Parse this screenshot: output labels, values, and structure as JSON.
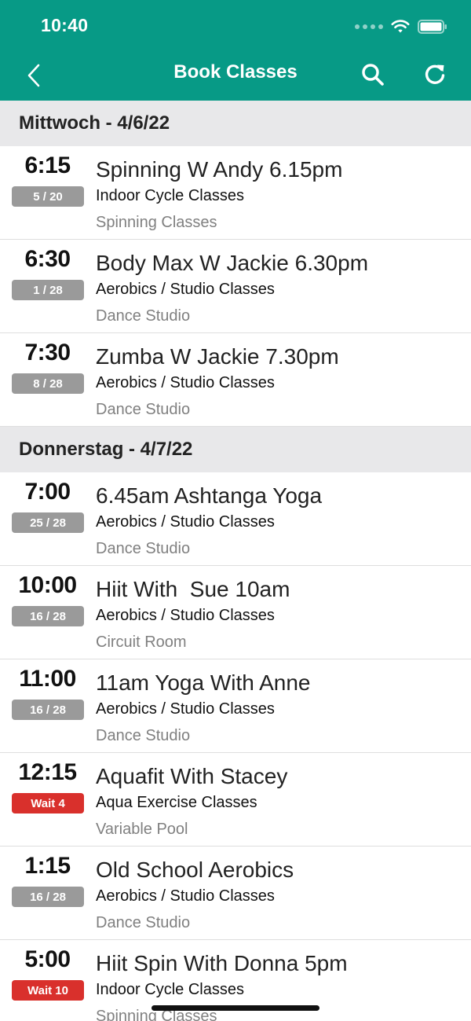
{
  "status_bar": {
    "time": "10:40"
  },
  "nav": {
    "title": "Book Classes",
    "back_icon": "chevron-left-icon",
    "search_icon": "search-icon",
    "refresh_icon": "refresh-icon"
  },
  "colors": {
    "primary": "#079A86",
    "badge_gray": "#9a9a9a",
    "badge_wait": "#d9302c"
  },
  "days": [
    {
      "header": "Mittwoch - 4/6/22",
      "classes": [
        {
          "time": "6:15",
          "badge": "5 / 20",
          "badge_type": "spots",
          "title": "Spinning W Andy 6.15pm",
          "category": "Indoor Cycle Classes",
          "location": "Spinning Classes"
        },
        {
          "time": "6:30",
          "badge": "1 / 28",
          "badge_type": "spots",
          "title": "Body Max W Jackie 6.30pm",
          "category": "Aerobics / Studio Classes",
          "location": "Dance Studio"
        },
        {
          "time": "7:30",
          "badge": "8 / 28",
          "badge_type": "spots",
          "title": "Zumba W Jackie 7.30pm",
          "category": "Aerobics / Studio Classes",
          "location": "Dance Studio"
        }
      ]
    },
    {
      "header": "Donnerstag - 4/7/22",
      "classes": [
        {
          "time": "7:00",
          "badge": "25 / 28",
          "badge_type": "spots",
          "title": "6.45am Ashtanga Yoga",
          "category": "Aerobics / Studio Classes",
          "location": "Dance Studio"
        },
        {
          "time": "10:00",
          "badge": "16 / 28",
          "badge_type": "spots",
          "title": "Hiit With  Sue 10am",
          "category": "Aerobics / Studio Classes",
          "location": "Circuit Room"
        },
        {
          "time": "11:00",
          "badge": "16 / 28",
          "badge_type": "spots",
          "title": "11am Yoga With Anne",
          "category": "Aerobics / Studio Classes",
          "location": "Dance Studio"
        },
        {
          "time": "12:15",
          "badge": "Wait 4",
          "badge_type": "wait",
          "title": "Aquafit With Stacey",
          "category": "Aqua Exercise Classes",
          "location": "Variable Pool"
        },
        {
          "time": "1:15",
          "badge": "16 / 28",
          "badge_type": "spots",
          "title": "Old School Aerobics",
          "category": "Aerobics / Studio Classes",
          "location": "Dance Studio"
        },
        {
          "time": "5:00",
          "badge": "Wait 10",
          "badge_type": "wait",
          "title": "Hiit Spin With Donna 5pm",
          "category": "Indoor Cycle Classes",
          "location": "Spinning Classes"
        }
      ]
    }
  ]
}
